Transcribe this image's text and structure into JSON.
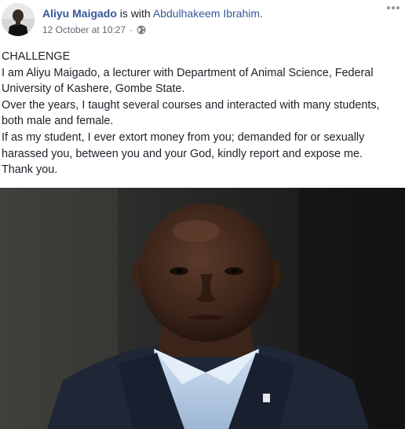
{
  "post": {
    "author": "Aliyu Maigado",
    "with_text": "is with",
    "tagged_user": "Abdulhakeem Ibrahim.",
    "timestamp": "12 October at 10:27",
    "separator": "·",
    "privacy_icon": "globe-icon",
    "menu_icon": "more-options-icon",
    "lines": [
      "CHALLENGE",
      "I am Aliyu Maigado, a lecturer with Department of Animal Science, Federal University of Kashere, Gombe State.",
      "Over the years, I taught several courses and interacted with many students, both male and female.",
      "If as my student, I ever extort money from you; demanded for or sexually harassed you, between you and your God, kindly report and expose me.",
      "Thank you."
    ]
  },
  "colors": {
    "link": "#365899",
    "text": "#1d2129",
    "meta": "#616770"
  }
}
